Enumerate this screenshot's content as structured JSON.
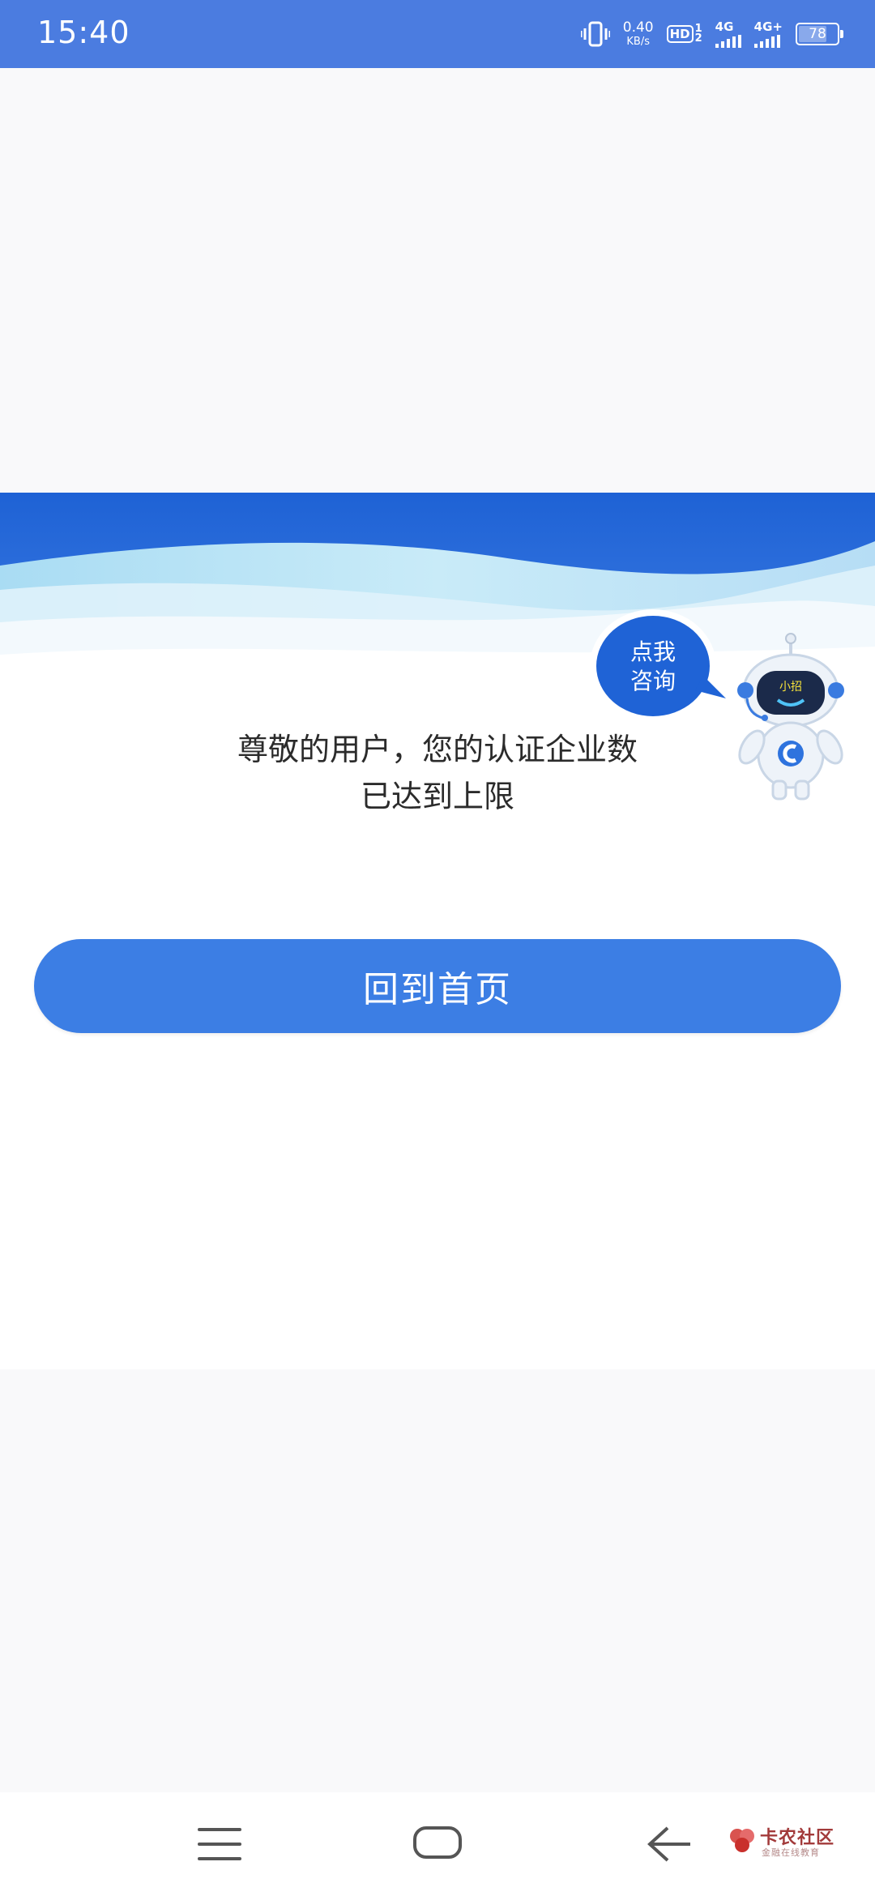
{
  "status_bar": {
    "time": "15:40",
    "net_speed_value": "0.40",
    "net_speed_unit": "KB/s",
    "hd_label": "HD",
    "sim1": "1",
    "sim2": "2",
    "signal1_label": "4G",
    "signal2_label": "4G+",
    "battery_level": "78"
  },
  "robot": {
    "bubble_line1": "点我",
    "bubble_line2": "咨询",
    "badge": "小招"
  },
  "message": {
    "line1": "尊敬的用户，您的认证企业数",
    "line2": "已达到上限"
  },
  "primary_button": {
    "label": "回到首页"
  },
  "watermark": {
    "text": "卡农社区",
    "subtext": "金融在线教育"
  },
  "colors": {
    "status_bar": "#4b7ce0",
    "banner_blue": "#1f63d6",
    "button": "#3c7ee4"
  }
}
